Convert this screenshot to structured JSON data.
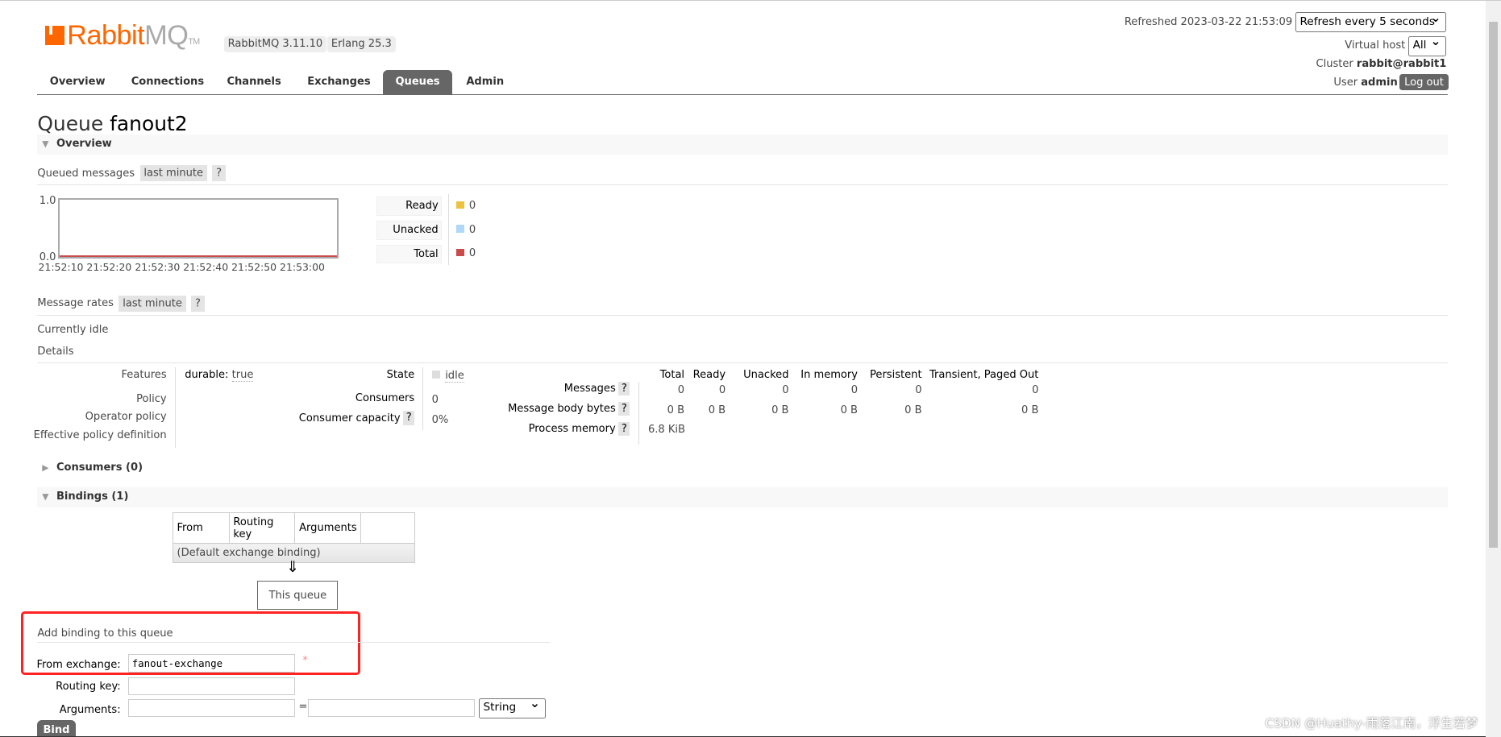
{
  "logo": {
    "brand": "Rabbit",
    "suffix": "MQ",
    "tm": "TM"
  },
  "versions": {
    "rabbitmq": "RabbitMQ 3.11.10",
    "erlang": "Erlang 25.3"
  },
  "header": {
    "refreshed": "Refreshed 2023-03-22 21:53:09",
    "refresh_select": "Refresh every 5 seconds",
    "vhost_label": "Virtual host",
    "vhost_select": "All",
    "cluster_label": "Cluster",
    "cluster": "rabbit@rabbit1",
    "user_label": "User",
    "user": "admin",
    "logout": "Log out"
  },
  "tabs": [
    {
      "label": "Overview"
    },
    {
      "label": "Connections"
    },
    {
      "label": "Channels"
    },
    {
      "label": "Exchanges"
    },
    {
      "label": "Queues",
      "active": true
    },
    {
      "label": "Admin"
    }
  ],
  "page": {
    "title_prefix": "Queue",
    "queue_name": "fanout2"
  },
  "overview": {
    "section": "Overview",
    "queued_label": "Queued messages",
    "range": "last minute",
    "help": "?",
    "chart": {
      "y_max": "1.0",
      "y_min": "0.0",
      "x_ticks": [
        "21:52:10",
        "21:52:20",
        "21:52:30",
        "21:52:40",
        "21:52:50",
        "21:53:00"
      ]
    },
    "legend": [
      {
        "label": "Ready",
        "value": "0",
        "color": "#edc240"
      },
      {
        "label": "Unacked",
        "value": "0",
        "color": "#afd8f8"
      },
      {
        "label": "Total",
        "value": "0",
        "color": "#cb4b4b"
      }
    ],
    "rates_label": "Message rates",
    "idle": "Currently idle",
    "details": "Details"
  },
  "details": {
    "features_label": "Features",
    "durable_key": "durable:",
    "durable_val": "true",
    "policy": "Policy",
    "operator_policy": "Operator policy",
    "effective_policy": "Effective policy definition",
    "state_label": "State",
    "state": "idle",
    "consumers_label": "Consumers",
    "consumers": "0",
    "capacity_label": "Consumer capacity",
    "capacity": "0%",
    "columns": [
      "Total",
      "Ready",
      "Unacked",
      "In memory",
      "Persistent",
      "Transient, Paged Out"
    ],
    "messages_label": "Messages",
    "messages": [
      "0",
      "0",
      "0",
      "0",
      "0",
      "0"
    ],
    "bytes_label": "Message body bytes",
    "bytes": [
      "0 B",
      "0 B",
      "0 B",
      "0 B",
      "0 B",
      "0 B"
    ],
    "memory_label": "Process memory",
    "memory": "6.8 KiB"
  },
  "consumers": {
    "section": "Consumers (0)"
  },
  "bindings": {
    "section": "Bindings (1)",
    "headers": [
      "From",
      "Routing key",
      "Arguments"
    ],
    "row": "(Default exchange binding)",
    "arrow": "⇓",
    "this_queue": "This queue"
  },
  "add_binding": {
    "title": "Add binding to this queue",
    "from_label": "From exchange:",
    "from_value": "fanout-exchange",
    "required": "*",
    "routing_label": "Routing key:",
    "routing_value": "",
    "args_label": "Arguments:",
    "eq": "=",
    "type": "String",
    "bind": "Bind"
  },
  "watermark": "CSDN @Huathy-雨落江南，浮生若梦"
}
